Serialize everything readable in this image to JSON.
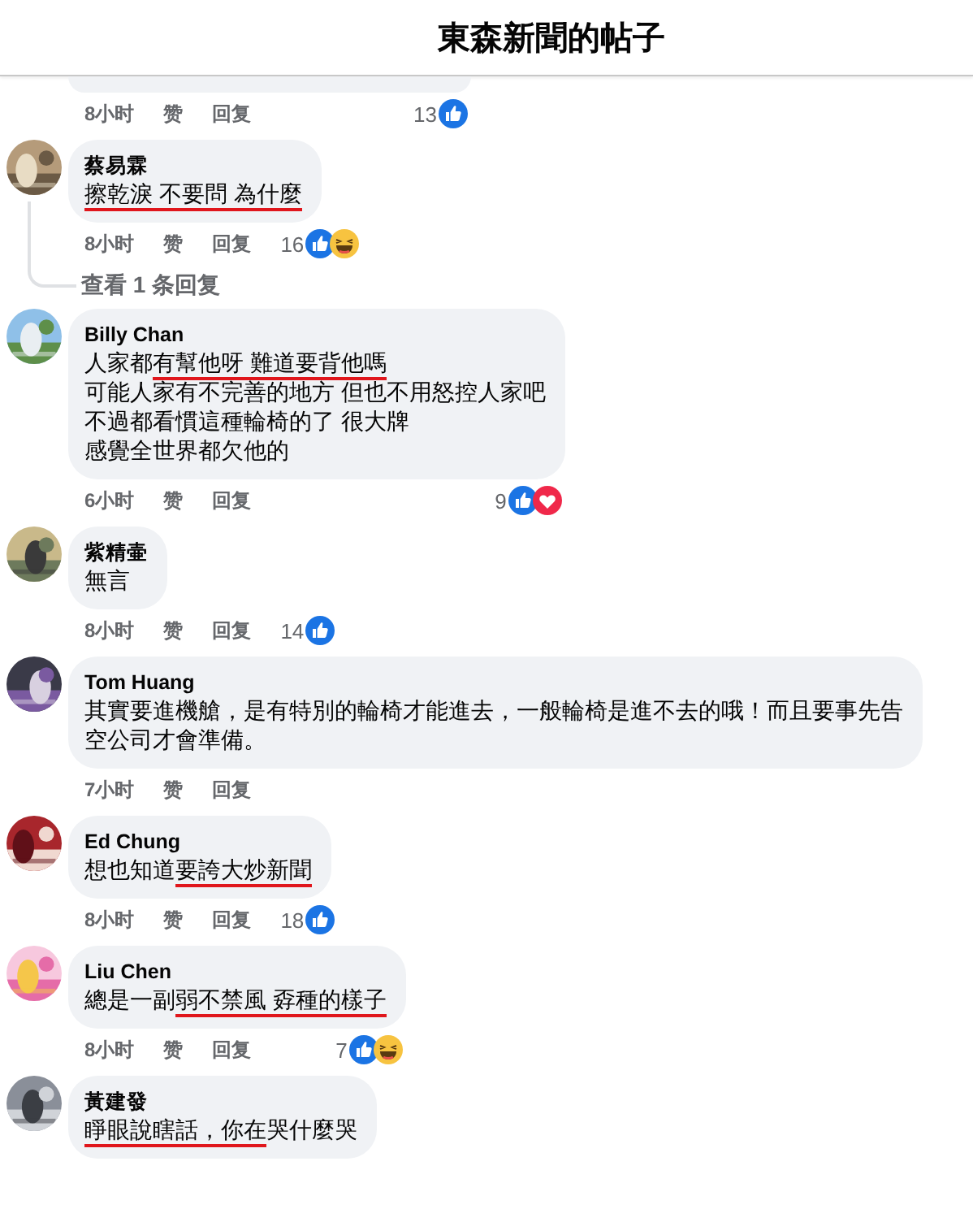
{
  "header": {
    "title": "東森新聞的帖子"
  },
  "comments": [
    {
      "kind": "partial",
      "time": "8小时",
      "like": "赞",
      "reply": "回复",
      "count": "13",
      "reactions": [
        {
          "kind": "like"
        }
      ]
    },
    {
      "kind": "full",
      "author": "蔡易霖",
      "lines": [
        [
          {
            "text": "擦乾淚 不要問 為什麼",
            "underlined": true
          }
        ]
      ],
      "time": "8小时",
      "like": "赞",
      "reply": "回复",
      "count": "16",
      "reactions": [
        {
          "kind": "like"
        },
        {
          "kind": "haha"
        }
      ],
      "replies_link": "查看 1 条回复"
    },
    {
      "kind": "full",
      "author": "Billy Chan",
      "lines": [
        [
          {
            "text": "人家都",
            "underlined": false
          },
          {
            "text": "有幫他呀 難道要背他嗎",
            "underlined": true
          }
        ],
        [
          {
            "text": "可能人家有不完善的地方 但也不用怒控人家吧",
            "underlined": false
          }
        ],
        [
          {
            "text": "不過都看慣這種輪椅的了 很大牌",
            "underlined": false
          }
        ],
        [
          {
            "text": "感覺全世界都欠他的",
            "underlined": false
          }
        ]
      ],
      "time": "6小时",
      "like": "赞",
      "reply": "回复",
      "count": "9",
      "reactions": [
        {
          "kind": "like"
        },
        {
          "kind": "love"
        }
      ]
    },
    {
      "kind": "full",
      "author": "紫精壷",
      "lines": [
        [
          {
            "text": "無言",
            "underlined": false
          }
        ]
      ],
      "time": "8小时",
      "like": "赞",
      "reply": "回复",
      "count": "14",
      "reactions": [
        {
          "kind": "like"
        }
      ]
    },
    {
      "kind": "full",
      "author": "Tom Huang",
      "lines": [
        [
          {
            "text": "其實要進機艙，是有特別的輪椅才能進去，一般輪椅是進不去的哦！而且要事先告",
            "underlined": false
          }
        ],
        [
          {
            "text": "空公司才會準備。",
            "underlined": false
          }
        ]
      ],
      "time": "7小时",
      "like": "赞",
      "reply": "回复"
    },
    {
      "kind": "full",
      "author": "Ed Chung",
      "lines": [
        [
          {
            "text": "想也知道",
            "underlined": false
          },
          {
            "text": "要誇大炒新聞",
            "underlined": true
          }
        ]
      ],
      "time": "8小时",
      "like": "赞",
      "reply": "回复",
      "count": "18",
      "reactions": [
        {
          "kind": "like"
        }
      ]
    },
    {
      "kind": "full",
      "author": "Liu Chen",
      "lines": [
        [
          {
            "text": "總是一副",
            "underlined": false
          },
          {
            "text": "弱不禁風 孬種的樣子",
            "underlined": true
          }
        ]
      ],
      "time": "8小时",
      "like": "赞",
      "reply": "回复",
      "count": "7",
      "reactions": [
        {
          "kind": "like"
        },
        {
          "kind": "haha"
        }
      ]
    },
    {
      "kind": "full",
      "author": "黃建發",
      "lines": [
        [
          {
            "text": "睜眼說瞎話，你在",
            "underlined": true
          },
          {
            "text": "哭什麼哭",
            "underlined": false
          }
        ]
      ]
    }
  ]
}
